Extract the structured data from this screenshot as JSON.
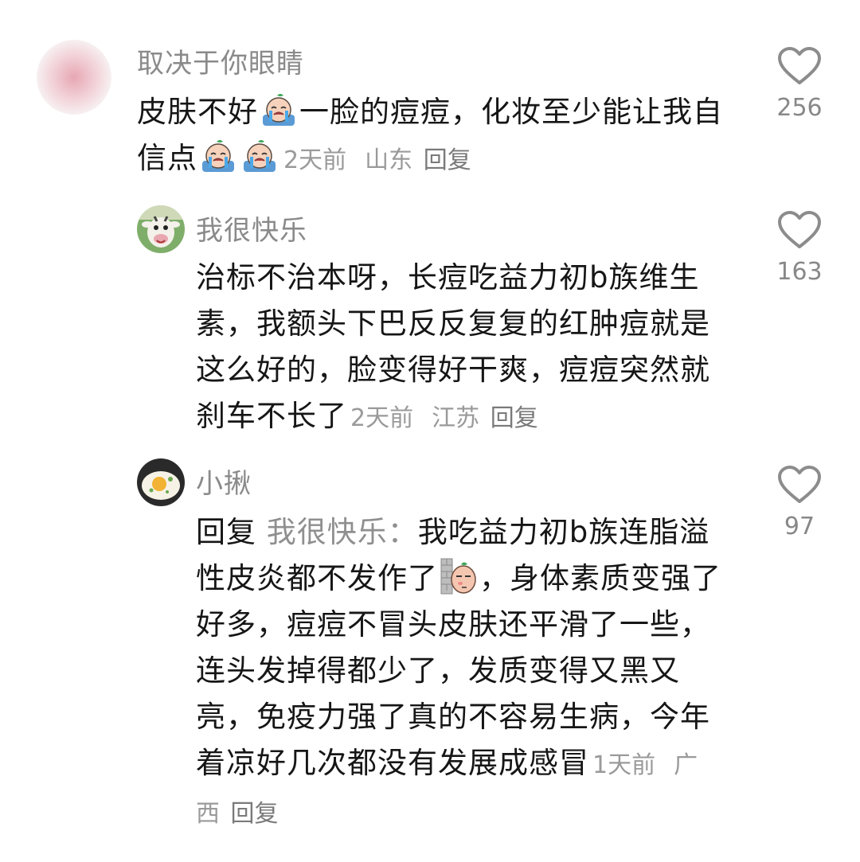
{
  "comments": [
    {
      "username": "取决于你眼睛",
      "text_parts": [
        "皮肤不好",
        "一脸的痘痘，化妆至少能让我自信点"
      ],
      "emoji": "crying-baby",
      "time": "2天前",
      "location": "山东",
      "reply_label": "回复",
      "likes": "256"
    },
    {
      "username": "我很快乐",
      "text": "治标不治本呀，长痘吃益力初b族维生素，我额头下巴反反复复的红肿痘就是这么好的，脸变得好干爽，痘痘突然就刹车不长了",
      "time": "2天前",
      "location": "江苏",
      "reply_label": "回复",
      "likes": "163"
    },
    {
      "username": "小揪",
      "reply_prefix": "回复",
      "reply_to": "我很快乐：",
      "text_parts": [
        "我吃益力初b族连脂溢性皮炎都不发作了",
        "，身体素质变强了好多，痘痘不冒头皮肤还平滑了一些，连头发掉得都少了，发质变得又黑又亮，免疫力强了真的不容易生病，今年着凉好几次都没有发展成感冒"
      ],
      "emoji": "peeking-wall",
      "time": "1天前",
      "location": "广西",
      "reply_label": "回复",
      "likes": "97"
    }
  ],
  "icons": {
    "like": "heart-outline-icon"
  },
  "colors": {
    "text": "#161616",
    "muted": "#8a8a8a"
  }
}
